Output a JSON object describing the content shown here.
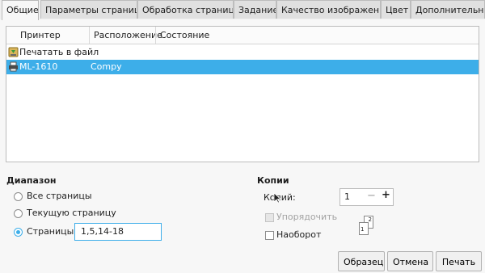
{
  "tabs": [
    {
      "label": "Общие",
      "active": true
    },
    {
      "label": "Параметры страницы"
    },
    {
      "label": "Обработка страницы"
    },
    {
      "label": "Задание"
    },
    {
      "label": "Качество изображения"
    },
    {
      "label": "Цвет"
    },
    {
      "label": "Дополнительно"
    }
  ],
  "printer_list": {
    "columns": [
      "Принтер",
      "Расположение",
      "Состояние"
    ],
    "rows": [
      {
        "name": "Печатать в файл",
        "location": "",
        "state": "",
        "icon": "save-to-file-icon"
      },
      {
        "name": "ML-1610",
        "location": "Compy",
        "state": "",
        "icon": "printer-icon",
        "selected": true
      }
    ]
  },
  "range": {
    "title": "Диапазон",
    "all_pages": "Все страницы",
    "current_page": "Текущую страницу",
    "pages_label": "Страницы:",
    "pages_value": "1,5,14-18",
    "selected": "pages"
  },
  "copies": {
    "title": "Копии",
    "count_label": "Копий:",
    "count_value": "1",
    "minus": "−",
    "plus": "+",
    "collate_label": "Упорядочить",
    "collate_checked": false,
    "collate_enabled": false,
    "reverse_label": "Наоборот",
    "reverse_checked": false,
    "preview_pages": [
      "1",
      "2"
    ]
  },
  "buttons": {
    "preview": "Образец",
    "cancel": "Отмена",
    "print": "Печать"
  },
  "colors": {
    "accent": "#3daee9"
  }
}
